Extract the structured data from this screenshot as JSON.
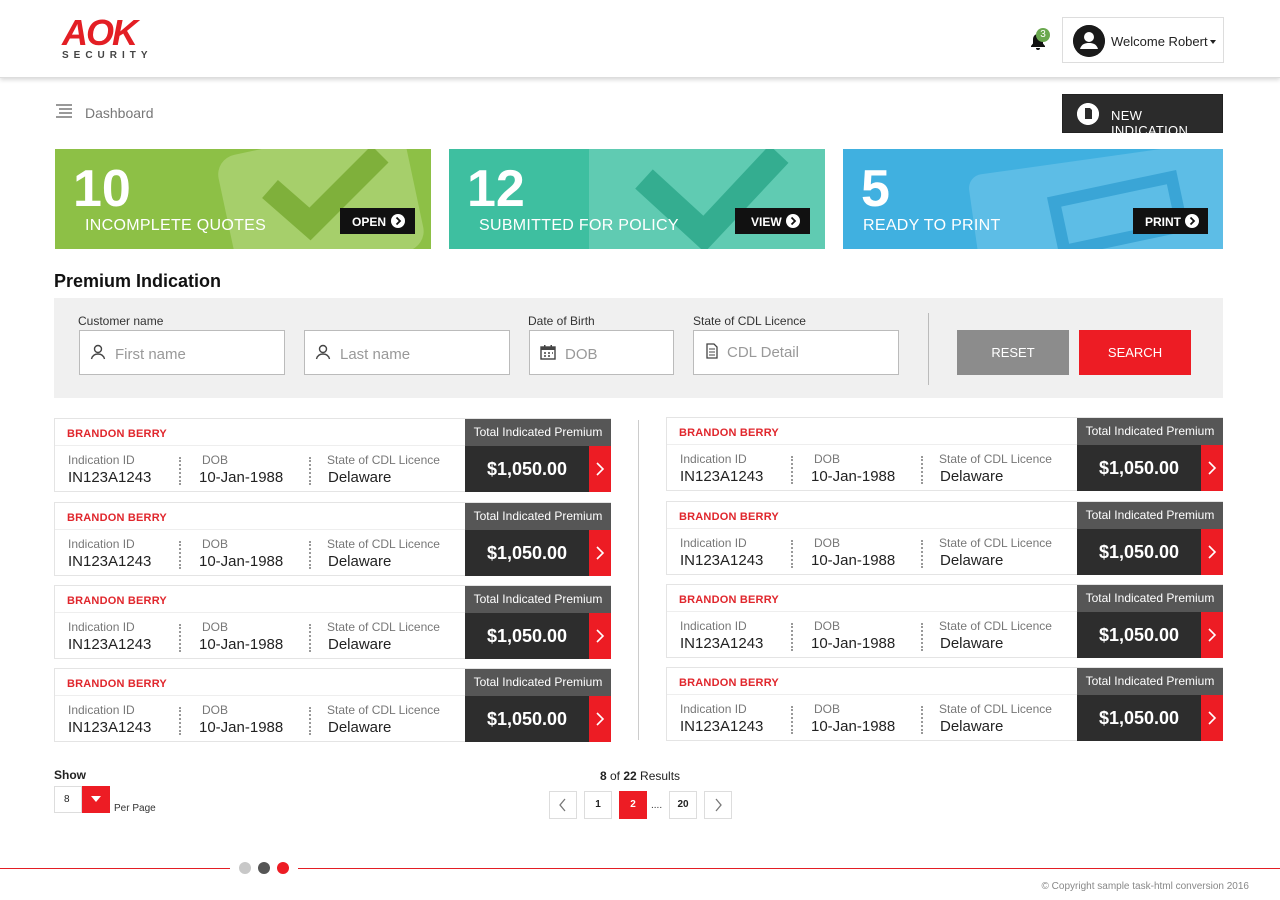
{
  "header": {
    "logo_text": "AOK",
    "logo_sub": "SECURITY",
    "notification_count": "3",
    "user_label": "Welcome Robert"
  },
  "toolbar": {
    "breadcrumb": "Dashboard",
    "new_button": "NEW INDICATION"
  },
  "cards": [
    {
      "count": "10",
      "label": "INCOMPLETE QUOTES",
      "button": "OPEN",
      "color": "#8dc046"
    },
    {
      "count": "12",
      "label": "SUBMITTED FOR POLICY",
      "button": "VIEW",
      "color": "#3ebfa0"
    },
    {
      "count": "5",
      "label": "READY TO PRINT",
      "button": "PRINT",
      "color": "#40b0e0"
    }
  ],
  "section_title": "Premium Indication",
  "filters": {
    "customer_label": "Customer name",
    "first_placeholder": "First name",
    "last_placeholder": "Last name",
    "dob_label": "Date of Birth",
    "dob_placeholder": "DOB",
    "state_label": "State of CDL Licence",
    "state_placeholder": "CDL Detail",
    "reset": "RESET",
    "search": "SEARCH"
  },
  "record_labels": {
    "id": "Indication ID",
    "dob": "DOB",
    "state": "State of CDL Licence",
    "premium": "Total Indicated Premium"
  },
  "records": [
    {
      "name": "BRANDON BERRY",
      "id": "IN123A1243",
      "dob": "10-Jan-1988",
      "state": "Delaware",
      "premium": "$1,050.00"
    },
    {
      "name": "BRANDON BERRY",
      "id": "IN123A1243",
      "dob": "10-Jan-1988",
      "state": "Delaware",
      "premium": "$1,050.00"
    },
    {
      "name": "BRANDON BERRY",
      "id": "IN123A1243",
      "dob": "10-Jan-1988",
      "state": "Delaware",
      "premium": "$1,050.00"
    },
    {
      "name": "BRANDON BERRY",
      "id": "IN123A1243",
      "dob": "10-Jan-1988",
      "state": "Delaware",
      "premium": "$1,050.00"
    },
    {
      "name": "BRANDON BERRY",
      "id": "IN123A1243",
      "dob": "10-Jan-1988",
      "state": "Delaware",
      "premium": "$1,050.00"
    },
    {
      "name": "BRANDON BERRY",
      "id": "IN123A1243",
      "dob": "10-Jan-1988",
      "state": "Delaware",
      "premium": "$1,050.00"
    },
    {
      "name": "BRANDON BERRY",
      "id": "IN123A1243",
      "dob": "10-Jan-1988",
      "state": "Delaware",
      "premium": "$1,050.00"
    },
    {
      "name": "BRANDON BERRY",
      "id": "IN123A1243",
      "dob": "10-Jan-1988",
      "state": "Delaware",
      "premium": "$1,050.00"
    }
  ],
  "pagination": {
    "show_label": "Show",
    "per_page_value": "8",
    "per_page_label": "Per Page",
    "shown": "8",
    "of": "of",
    "total": "22",
    "results_word": "Results",
    "pages": [
      "1",
      "2",
      "....",
      "20"
    ],
    "active_page": "2"
  },
  "footer": {
    "copyright": "© Copyright sample task-html conversion 2016"
  },
  "colors": {
    "accent": "#ed1c24",
    "dark": "#2d2d2d"
  }
}
